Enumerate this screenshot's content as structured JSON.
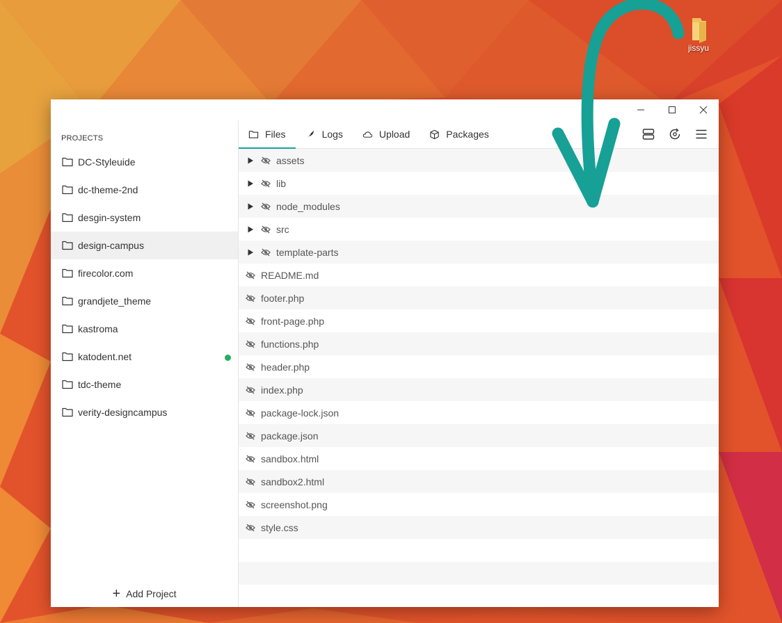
{
  "desktop": {
    "icon_label": "jissyu"
  },
  "window": {
    "controls": [
      "minimize",
      "maximize",
      "close"
    ]
  },
  "sidebar": {
    "heading": "PROJECTS",
    "projects": [
      {
        "name": "DC-Styleuide",
        "active": false,
        "status": false
      },
      {
        "name": "dc-theme-2nd",
        "active": false,
        "status": false
      },
      {
        "name": "desgin-system",
        "active": false,
        "status": false
      },
      {
        "name": "design-campus",
        "active": true,
        "status": false
      },
      {
        "name": "firecolor.com",
        "active": false,
        "status": false
      },
      {
        "name": "grandjete_theme",
        "active": false,
        "status": false
      },
      {
        "name": "kastroma",
        "active": false,
        "status": false
      },
      {
        "name": "katodent.net",
        "active": false,
        "status": true
      },
      {
        "name": "tdc-theme",
        "active": false,
        "status": false
      },
      {
        "name": "verity-designcampus",
        "active": false,
        "status": false
      }
    ],
    "add_project_label": "Add Project",
    "status_color": "#27ae60"
  },
  "tabs": [
    {
      "label": "Files",
      "icon": "folder-icon",
      "active": true
    },
    {
      "label": "Logs",
      "icon": "feather-icon",
      "active": false
    },
    {
      "label": "Upload",
      "icon": "cloud-icon",
      "active": false
    },
    {
      "label": "Packages",
      "icon": "package-icon",
      "active": false
    }
  ],
  "tools": [
    "server-icon",
    "refresh-settings-icon",
    "menu-icon"
  ],
  "files": [
    {
      "name": "assets",
      "type": "folder"
    },
    {
      "name": "lib",
      "type": "folder"
    },
    {
      "name": "node_modules",
      "type": "folder"
    },
    {
      "name": "src",
      "type": "folder"
    },
    {
      "name": "template-parts",
      "type": "folder"
    },
    {
      "name": "README.md",
      "type": "file"
    },
    {
      "name": "footer.php",
      "type": "file"
    },
    {
      "name": "front-page.php",
      "type": "file"
    },
    {
      "name": "functions.php",
      "type": "file"
    },
    {
      "name": "header.php",
      "type": "file"
    },
    {
      "name": "index.php",
      "type": "file"
    },
    {
      "name": "package-lock.json",
      "type": "file"
    },
    {
      "name": "package.json",
      "type": "file"
    },
    {
      "name": "sandbox.html",
      "type": "file"
    },
    {
      "name": "sandbox2.html",
      "type": "file"
    },
    {
      "name": "screenshot.png",
      "type": "file"
    },
    {
      "name": "style.css",
      "type": "file"
    }
  ],
  "colors": {
    "accent": "#1aa39a",
    "arrow": "#17a095"
  }
}
